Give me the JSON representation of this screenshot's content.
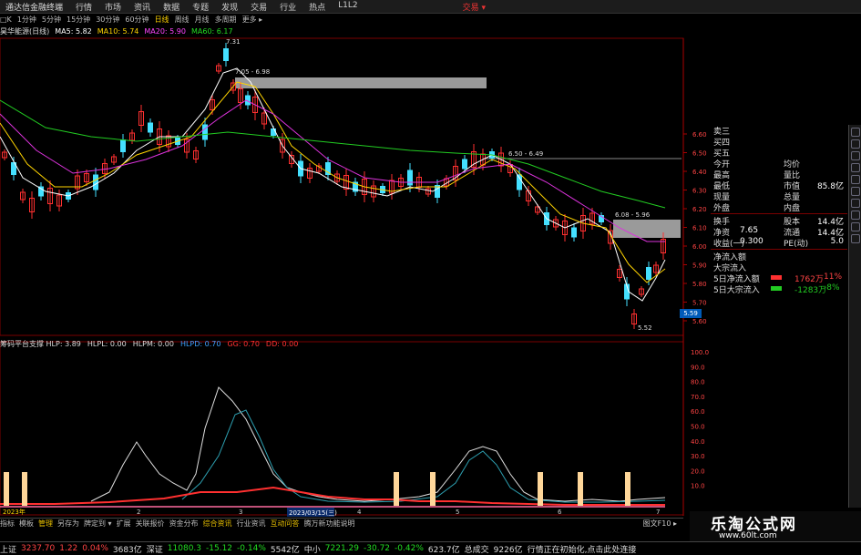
{
  "topbar": {
    "app": "通达信金融终端",
    "menus": [
      "行情",
      "市场",
      "资讯",
      "数据",
      "专题",
      "发现",
      "交易",
      "行业",
      "热点",
      "L1L2"
    ],
    "trade": "交易 ▾"
  },
  "periodbar": {
    "items": [
      "□K",
      "1分钟",
      "5分钟",
      "15分钟",
      "30分钟",
      "60分钟",
      "日线",
      "周线",
      "月线",
      "多周期",
      "更多 ▸"
    ],
    "active": "日线"
  },
  "mabar": {
    "stock": "昊华能源(日线)",
    "items": [
      {
        "text": "MA5: 5.82",
        "color": "#ffffff"
      },
      {
        "text": "MA10: 5.74",
        "color": "#ffd400"
      },
      {
        "text": "MA20: 5.90",
        "color": "#ff44ff"
      },
      {
        "text": "MA60: 6.17",
        "color": "#22dd22"
      }
    ]
  },
  "annotations": {
    "high": "7.31",
    "band1": "7.05 - 6.98",
    "band2": "6.50 - 6.49",
    "band3": "6.08 - 5.96",
    "low": "5.52"
  },
  "price_axis": [
    "6.60",
    "6.50",
    "6.40",
    "6.30",
    "6.20",
    "6.10",
    "6.00",
    "5.90",
    "5.80",
    "5.70",
    "5.60"
  ],
  "price_tag": "5.59",
  "indicator": {
    "items": [
      {
        "text": "筹码平台支撑 HLP: 3.89",
        "color": "#dddddd"
      },
      {
        "text": "HLPL: 0.00",
        "color": "#dddddd"
      },
      {
        "text": "HLPM: 0.00",
        "color": "#dddddd"
      },
      {
        "text": "HLPD: 0.70",
        "color": "#3aa0ff"
      },
      {
        "text": "GG: 0.70",
        "color": "#ff3333"
      },
      {
        "text": "DD: 0.00",
        "color": "#ff3333"
      }
    ]
  },
  "ind_axis": [
    "100.0",
    "90.0",
    "80.0",
    "70.0",
    "60.0",
    "50.0",
    "40.0",
    "30.0",
    "20.0",
    "10.0"
  ],
  "xaxis": {
    "year": "2023年",
    "date": "2023/03/15(三)",
    "months": [
      "2",
      "3",
      "4",
      "5",
      "6",
      "7"
    ]
  },
  "tabs": {
    "items": [
      "指标",
      "模板",
      "管理",
      "另存为",
      "牌定到 ▾",
      "扩展",
      "关联报价",
      "资金分布",
      "综合资讯",
      "行业资讯",
      "互动问答",
      "腾万新功能说明"
    ],
    "highlight": [
      "管理",
      "综合资讯",
      "互动问答"
    ],
    "right": "图文F10 ▸"
  },
  "quote": {
    "rows": [
      {
        "k1": "卖三",
        "v1": "",
        "k2": "",
        "v2": ""
      },
      {
        "k1": "买四",
        "v1": "",
        "k2": "",
        "v2": ""
      },
      {
        "k1": "买五",
        "v1": "",
        "k2": "",
        "v2": ""
      },
      {
        "k1": "今开",
        "v1": "",
        "k2": "均价",
        "v2": ""
      },
      {
        "k1": "最高",
        "v1": "",
        "k2": "量比",
        "v2": ""
      },
      {
        "k1": "最低",
        "v1": "",
        "k2": "市值",
        "v2": "85.8亿"
      },
      {
        "k1": "现量",
        "v1": "",
        "k2": "总量",
        "v2": ""
      },
      {
        "k1": "外盘",
        "v1": "",
        "k2": "内盘",
        "v2": ""
      }
    ],
    "rows2": [
      {
        "k1": "换手",
        "v1": "",
        "k2": "股本",
        "v2": "14.4亿"
      },
      {
        "k1": "净资",
        "v1": "7.65",
        "k2": "流通",
        "v2": "14.4亿"
      },
      {
        "k1": "收益(一)",
        "v1": "0.300",
        "k2": "PE(动)",
        "v2": "5.0"
      }
    ],
    "flow": [
      {
        "k": "净流入额",
        "bar": "",
        "v3": "",
        "v4": ""
      },
      {
        "k": "大宗流入",
        "bar": "",
        "v3": "",
        "v4": ""
      },
      {
        "k": "5日净流入额",
        "bar": "#ff3030",
        "v3": "1762万",
        "v4": "11%",
        "c3": "#ff4444"
      },
      {
        "k": "5日大宗流入",
        "bar": "#22cc22",
        "v3": "-1283万",
        "v4": "-8%",
        "c3": "#22cc22"
      }
    ]
  },
  "status": {
    "items": [
      {
        "text": "上证",
        "color": "#dddddd"
      },
      {
        "text": "3237.70",
        "color": "#ff4444"
      },
      {
        "text": "1.22",
        "color": "#ff4444"
      },
      {
        "text": "0.04%",
        "color": "#ff4444"
      },
      {
        "text": "3683亿",
        "color": "#dddddd"
      },
      {
        "text": "深证",
        "color": "#dddddd"
      },
      {
        "text": "11080.3",
        "color": "#22dd22"
      },
      {
        "text": "-15.12",
        "color": "#22dd22"
      },
      {
        "text": "-0.14%",
        "color": "#22dd22"
      },
      {
        "text": "5542亿",
        "color": "#dddddd"
      },
      {
        "text": "中小",
        "color": "#dddddd"
      },
      {
        "text": "7221.29",
        "color": "#22dd22"
      },
      {
        "text": "-30.72",
        "color": "#22dd22"
      },
      {
        "text": "-0.42%",
        "color": "#22dd22"
      },
      {
        "text": "623.7亿",
        "color": "#dddddd"
      },
      {
        "text": "总成交",
        "color": "#dddddd"
      },
      {
        "text": "9226亿",
        "color": "#dddddd"
      },
      {
        "text": "行情正在初始化,点击此处连接",
        "color": "#dddddd"
      }
    ]
  },
  "watermark": {
    "title": "乐淘公式网",
    "url": "www.60lt.com"
  },
  "colors": {
    "up": "#ff3030",
    "down": "#44e0ff",
    "grid": "#7a0000"
  }
}
